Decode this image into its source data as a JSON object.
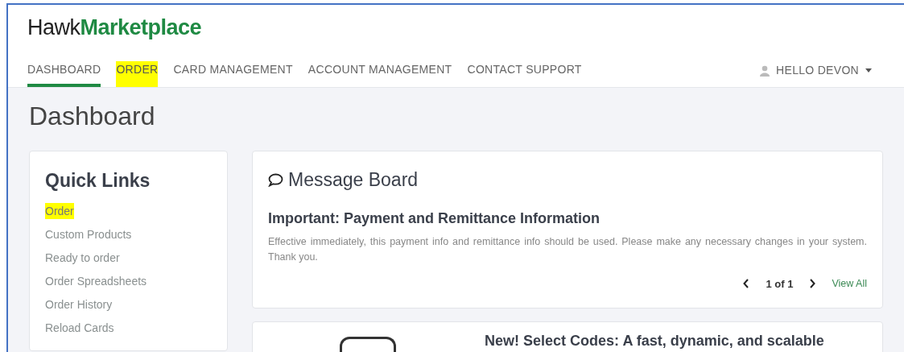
{
  "logo": {
    "brand_part_1": "Hawk",
    "brand_part_2": "Marketplace"
  },
  "nav": [
    {
      "label": "DASHBOARD",
      "selected": true,
      "highlighted": false
    },
    {
      "label": "ORDER",
      "selected": false,
      "highlighted": true
    },
    {
      "label": "CARD MANAGEMENT",
      "selected": false,
      "highlighted": false
    },
    {
      "label": "ACCOUNT MANAGEMENT",
      "selected": false,
      "highlighted": false
    },
    {
      "label": "CONTACT SUPPORT",
      "selected": false,
      "highlighted": false
    }
  ],
  "user_menu": {
    "label": "HELLO DEVON"
  },
  "page_title": "Dashboard",
  "quick_links": {
    "title": "Quick Links",
    "items": [
      {
        "label": "Order",
        "highlighted": true
      },
      {
        "label": "Custom Products",
        "highlighted": false
      },
      {
        "label": "Ready to order",
        "highlighted": false
      },
      {
        "label": "Order Spreadsheets",
        "highlighted": false
      },
      {
        "label": "Order History",
        "highlighted": false
      },
      {
        "label": "Reload Cards",
        "highlighted": false
      }
    ]
  },
  "message_board": {
    "title": "Message Board",
    "heading": "Important: Payment and Remittance Information",
    "body": "Effective immediately, this payment info and remittance info should be used. Please make any necessary changes in your system. Thank you.",
    "pager": "1 of 1",
    "view_all": "View All"
  },
  "promo": {
    "title": "New! Select Codes: A fast, dynamic, and scalable"
  }
}
